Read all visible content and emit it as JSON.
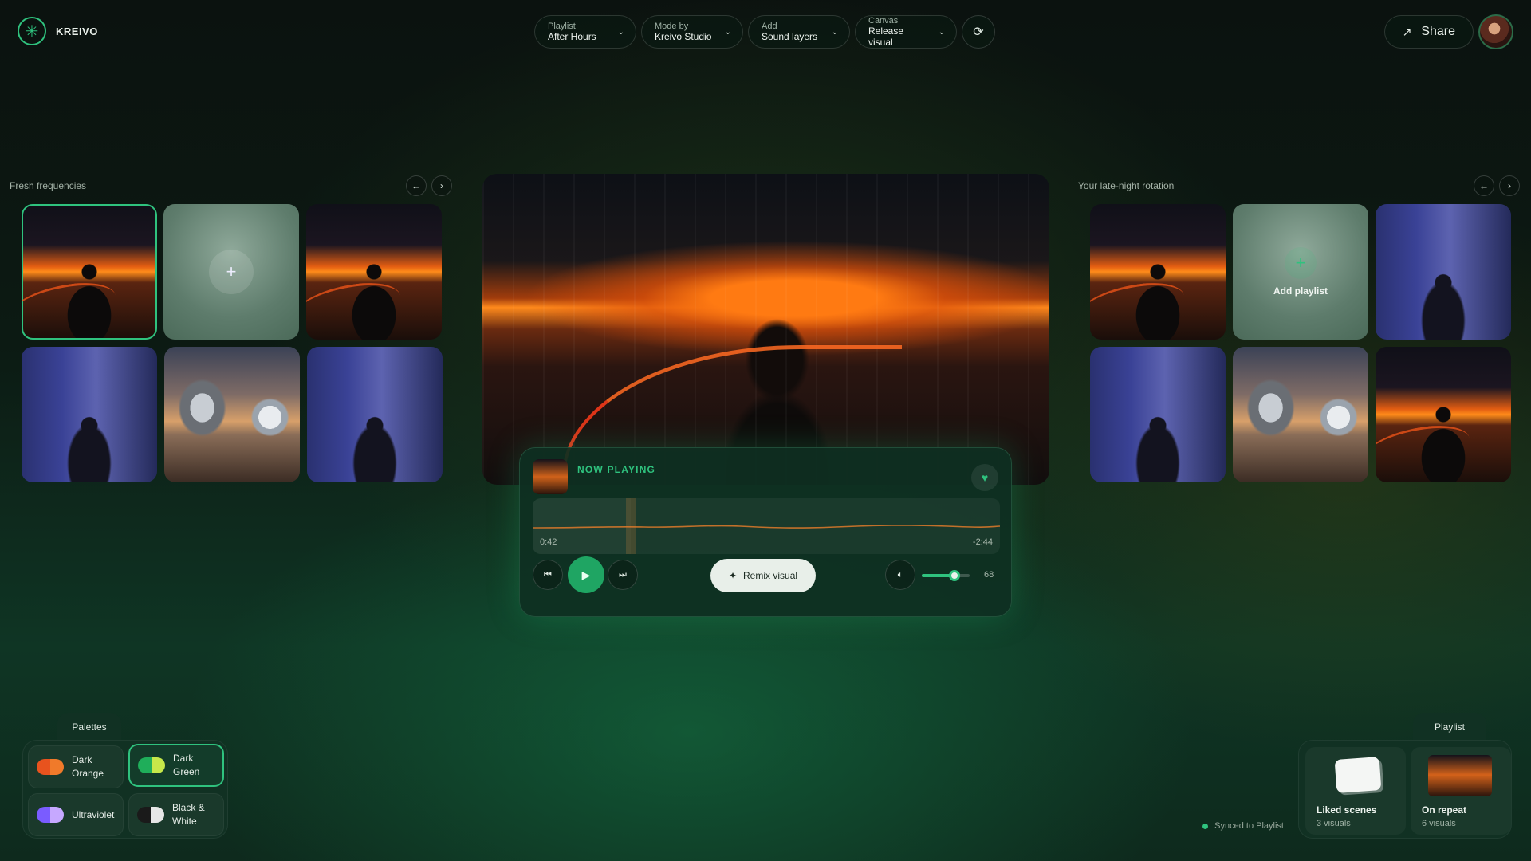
{
  "app": {
    "name": "KREIVO"
  },
  "topbar": {
    "pills": [
      {
        "key": "Playlist",
        "value": "After Hours"
      },
      {
        "key": "Mode by",
        "value": "Kreivo Studio"
      },
      {
        "key": "Add",
        "value": "Sound layers"
      },
      {
        "key": "Canvas",
        "value": "Release visual"
      }
    ],
    "share_label": "Share"
  },
  "left_section": {
    "title": "Fresh frequencies"
  },
  "right_section": {
    "title": "Your late-night rotation",
    "add_label": "Add playlist"
  },
  "player": {
    "now_playing_label": "NOW PLAYING",
    "elapsed": "0:42",
    "remaining": "-2:44",
    "progress_fraction": 0.21,
    "remix_label": "Remix visual",
    "volume": "68",
    "volume_fraction": 0.68
  },
  "palettes": {
    "tab_label": "Palettes",
    "items": [
      {
        "line1": "Dark",
        "line2": "Orange",
        "colors": [
          "#e8531e",
          "#f07a2a"
        ]
      },
      {
        "line1": "Dark",
        "line2": "Green",
        "colors": [
          "#1fae5a",
          "#c6e84a"
        ]
      },
      {
        "line1": "Ultraviolet",
        "line2": "",
        "colors": [
          "#7a5cff",
          "#c6a8ff"
        ]
      },
      {
        "line1": "Black &",
        "line2": "White",
        "colors": [
          "#1a1a1a",
          "#e6e6e6"
        ]
      }
    ]
  },
  "playlist_panel": {
    "tab_label": "Playlist",
    "status": "Synced to Playlist",
    "cards": [
      {
        "name": "Liked scenes",
        "sub": "3 visuals"
      },
      {
        "name": "On repeat",
        "sub": "6 visuals"
      }
    ]
  },
  "colors": {
    "accent": "#2fc27e",
    "waveform": "#e07a2a"
  }
}
